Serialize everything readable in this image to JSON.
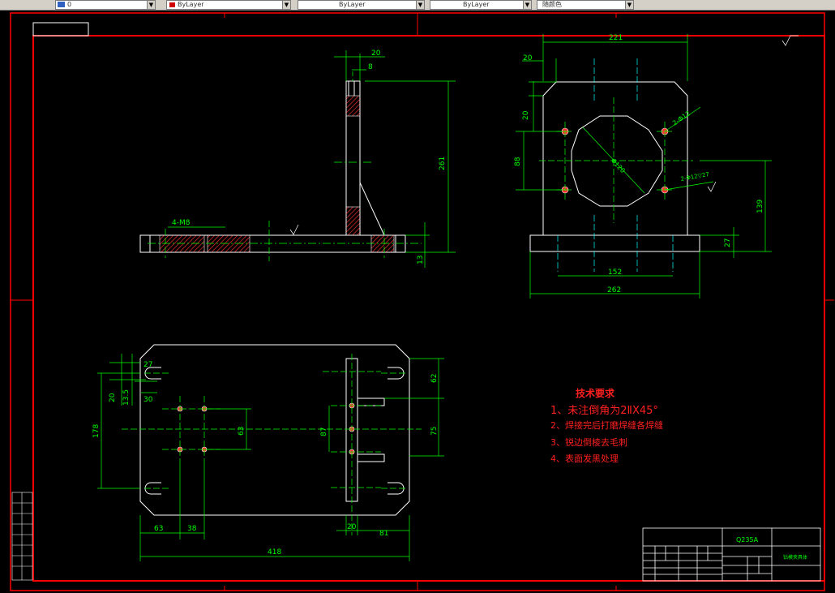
{
  "toolbar": {
    "layer_value": "0",
    "color_value": "ByLayer",
    "linetype_value": "ByLayer",
    "lineweight_value": "ByLayer",
    "plotstyle_value": "随颜色"
  },
  "colors": {
    "background": "#000000",
    "frame": "#ff0000",
    "outline": "#ffffff",
    "centerline": "#00ff00",
    "dimension": "#00ff00",
    "hatch": "#ff3030",
    "note": "#ff2020",
    "cyan": "#00ffff"
  },
  "drawing": {
    "front_view": {
      "dims": {
        "d20": "20",
        "d8": "8",
        "d261": "261",
        "d13": "13",
        "m8": "4-M8"
      }
    },
    "side_view": {
      "dims": {
        "d221": "221",
        "d20a": "20",
        "d20b": "20",
        "d88": "88",
        "d139": "139",
        "d27": "27",
        "d152": "152",
        "d262": "262"
      },
      "callouts": {
        "hole_a": "2-Φ12",
        "hole_b": "2-Φ12▽27",
        "bore": "Φ120"
      }
    },
    "plan_view": {
      "dims": {
        "d27": "27",
        "d20": "20",
        "d13_5": "13.5",
        "d30": "30",
        "d178": "178",
        "d63v": "63",
        "d87": "87",
        "d63h": "63",
        "d38": "38",
        "d418": "418",
        "d20b": "20",
        "d81": "81",
        "d62": "62",
        "d75": "75"
      }
    }
  },
  "notes": {
    "title": "技术要求",
    "items": [
      "1、未注倒角为2ⅡX45°",
      "2、焊接完后打磨焊缝各焊缝",
      "3、锐边倒棱去毛刺",
      "4、表面发黑处理"
    ]
  },
  "title_block": {
    "material": "Q235A",
    "drawing_name": "钻模夹具体"
  }
}
